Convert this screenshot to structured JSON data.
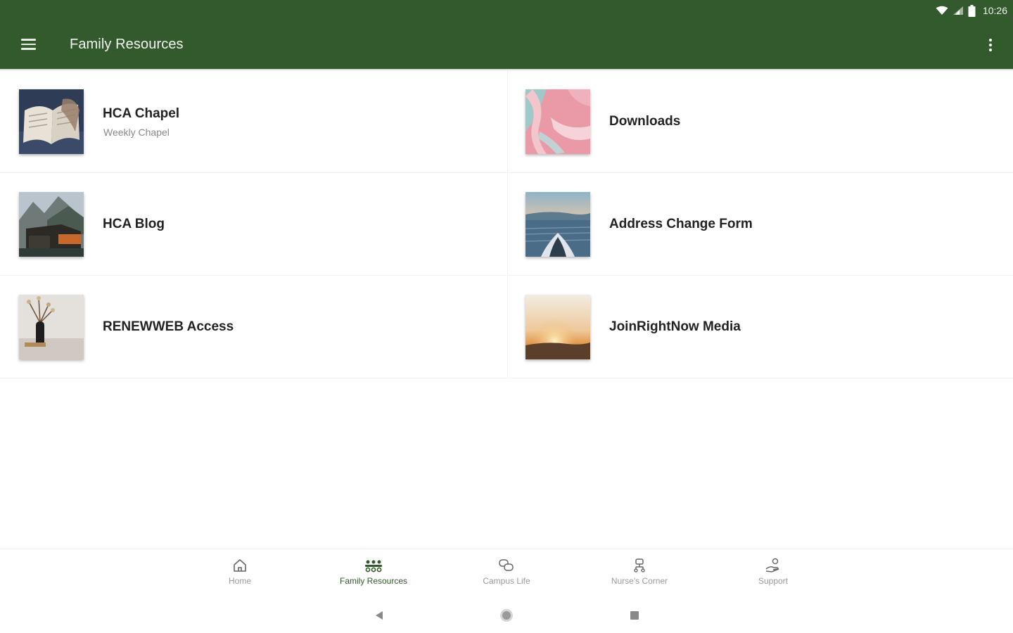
{
  "status_bar": {
    "time": "10:26"
  },
  "app_bar": {
    "title": "Family Resources",
    "color": "#335a2c"
  },
  "tiles": [
    {
      "title": "HCA Chapel",
      "subtitle": "Weekly Chapel",
      "image": "open-book-photo"
    },
    {
      "title": "Downloads",
      "subtitle": "",
      "image": "pink-abstract-photo"
    },
    {
      "title": "HCA Blog",
      "subtitle": "",
      "image": "mountain-cabin-photo"
    },
    {
      "title": "Address Change Form",
      "subtitle": "",
      "image": "kayak-lake-photo"
    },
    {
      "title": "RENEWWEB Access",
      "subtitle": "",
      "image": "vase-flowers-photo"
    },
    {
      "title": "JoinRightNow Media",
      "subtitle": "",
      "image": "sunset-photo"
    }
  ],
  "bottom_nav": {
    "items": [
      {
        "label": "Home",
        "icon": "home-icon",
        "active": false
      },
      {
        "label": "Family Resources",
        "icon": "family-icon",
        "active": true
      },
      {
        "label": "Campus Life",
        "icon": "chat-bubbles-icon",
        "active": false
      },
      {
        "label": "Nurse's Corner",
        "icon": "nurse-icon",
        "active": false
      },
      {
        "label": "Support",
        "icon": "support-icon",
        "active": false
      }
    ]
  },
  "system_nav": {
    "buttons": [
      "back-icon",
      "home-circle-icon",
      "recents-square-icon"
    ]
  }
}
